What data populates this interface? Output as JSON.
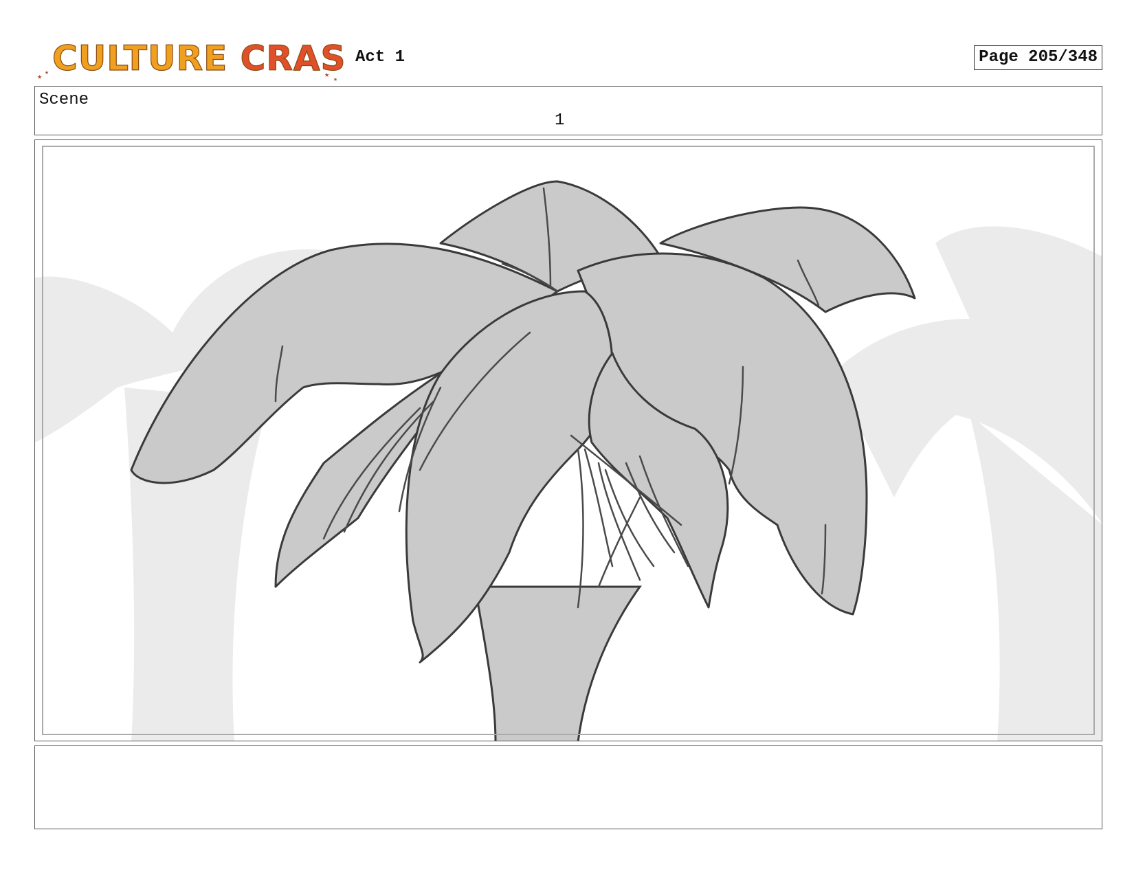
{
  "header": {
    "logo_text": "CULTURE CRASH",
    "act_label": "Act 1",
    "page_label": "Page 205/348"
  },
  "scene": {
    "label": "Scene",
    "number": "1"
  },
  "panel": {
    "content_icon": "palm-tree-sketch-icon"
  },
  "notes": {
    "text": ""
  },
  "colors": {
    "logo_orange": "#f0a020",
    "logo_red": "#e0502a",
    "leaf_fill": "#cacaca",
    "bg_tree_fill": "#ebebeb",
    "line": "#3a3a3a"
  }
}
